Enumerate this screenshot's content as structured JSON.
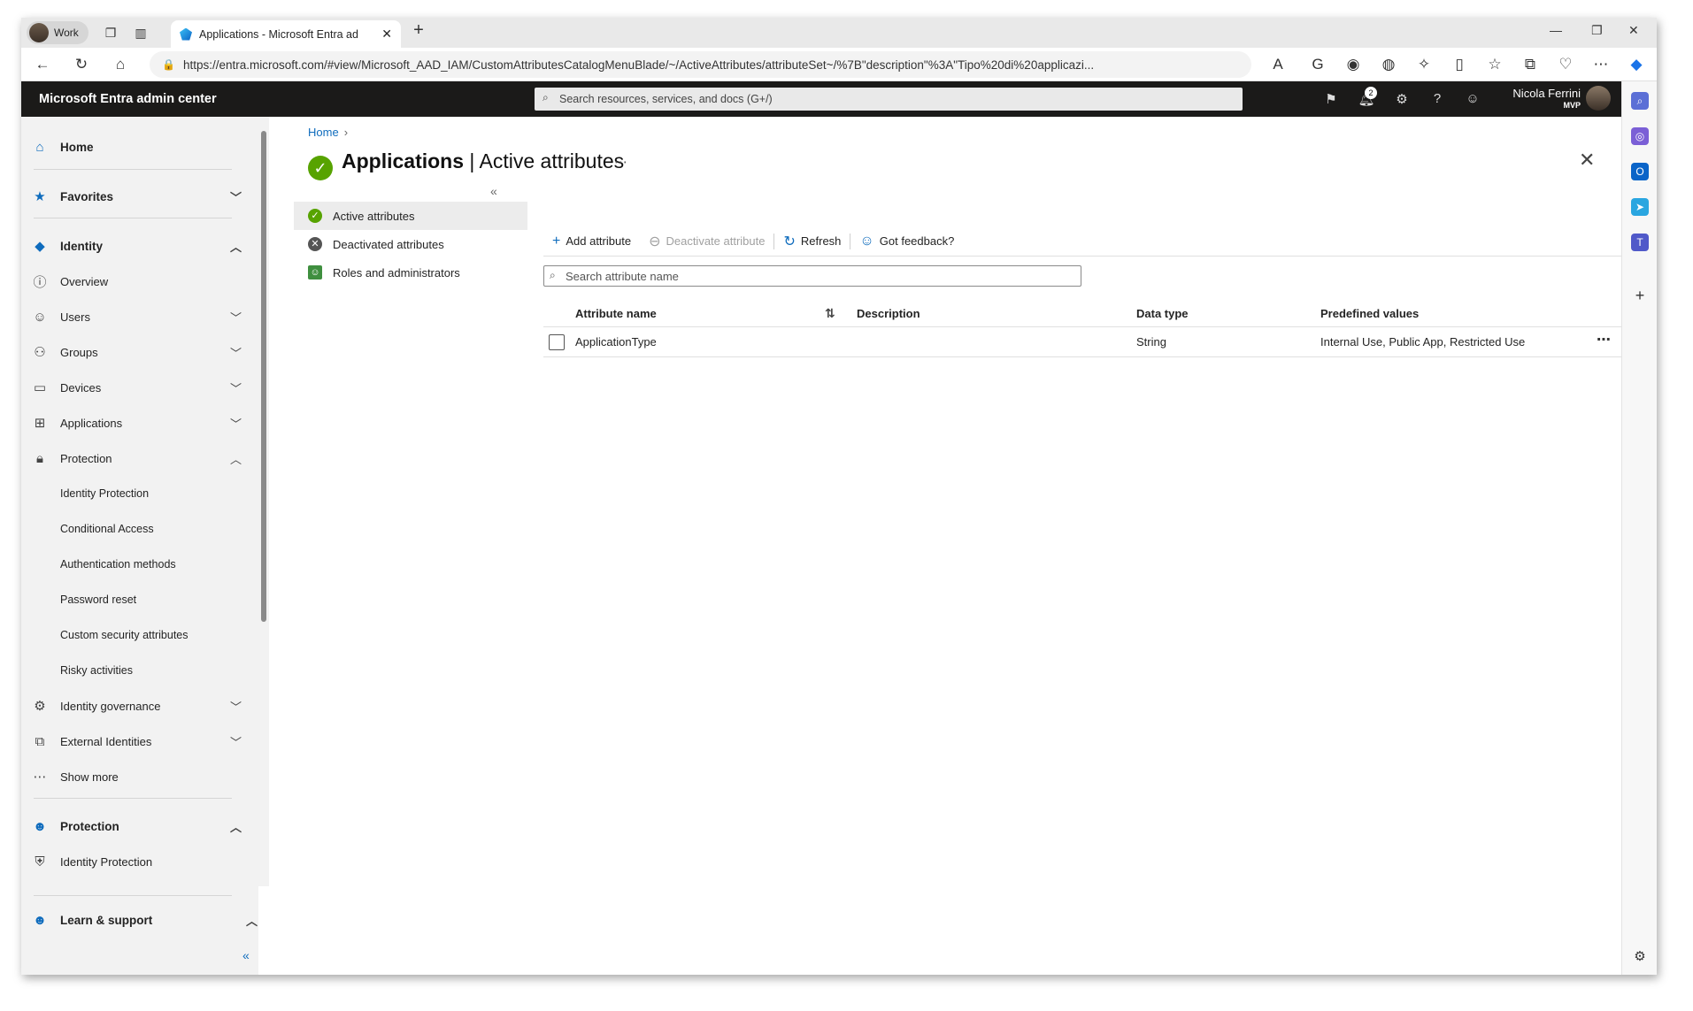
{
  "browser": {
    "profile_label": "Work",
    "tab_title": "Applications - Microsoft Entra ad",
    "url": "https://entra.microsoft.com/#view/Microsoft_AAD_IAM/CustomAttributesCatalogMenuBlade/~/ActiveAttributes/attributeSet~/%7B\"description\"%3A\"Tipo%20di%20applicazi..."
  },
  "header": {
    "brand": "Microsoft Entra admin center",
    "search_placeholder": "Search resources, services, and docs (G+/)",
    "notification_count": "2",
    "user_name": "Nicola Ferrini",
    "user_tier": "MVP"
  },
  "leftnav": {
    "home": "Home",
    "favorites": "Favorites",
    "identity": "Identity",
    "overview": "Overview",
    "users": "Users",
    "groups": "Groups",
    "devices": "Devices",
    "applications": "Applications",
    "protection": "Protection",
    "identity_protection": "Identity Protection",
    "conditional_access": "Conditional Access",
    "authentication_methods": "Authentication methods",
    "password_reset": "Password reset",
    "custom_security_attributes": "Custom security attributes",
    "risky_activities": "Risky activities",
    "identity_governance": "Identity governance",
    "external_identities": "External Identities",
    "show_more": "Show more",
    "protection_section": "Protection",
    "identity_protection_2": "Identity Protection",
    "learn_support": "Learn & support"
  },
  "main": {
    "breadcrumb_home": "Home",
    "title_service": "Applications",
    "title_page": "Active attributes",
    "blade_nav": {
      "active_attributes": "Active attributes",
      "deactivated_attributes": "Deactivated attributes",
      "roles_admins": "Roles and administrators"
    },
    "toolbar": {
      "add_attribute": "Add attribute",
      "deactivate_attribute": "Deactivate attribute",
      "refresh": "Refresh",
      "feedback": "Got feedback?"
    },
    "filter_placeholder": "Search attribute name",
    "table": {
      "headers": {
        "name": "Attribute name",
        "description": "Description",
        "data_type": "Data type",
        "predefined": "Predefined values"
      },
      "rows": [
        {
          "name": "ApplicationType",
          "description": "",
          "data_type": "String",
          "predefined": "Internal Use, Public App, Restricted Use"
        }
      ]
    }
  },
  "colors": {
    "portal_header": "#1b1a19",
    "accent": "#0f6cbd",
    "success": "#57a300"
  }
}
